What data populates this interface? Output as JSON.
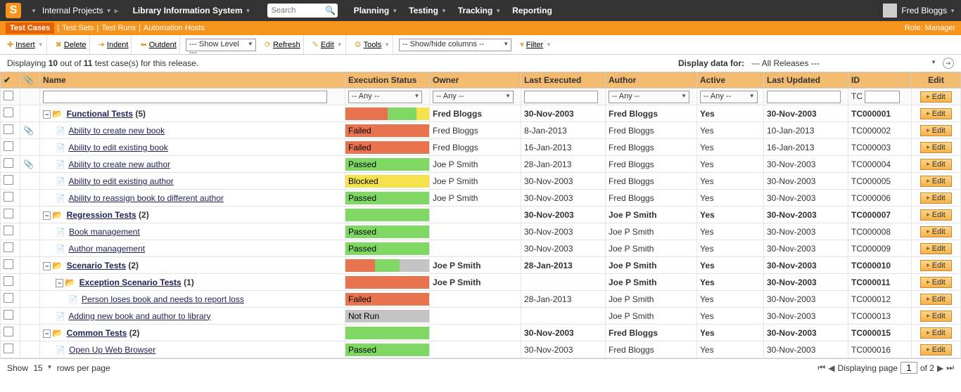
{
  "top": {
    "breadcrumb1": "Internal Projects",
    "breadcrumb2": "Library Information System",
    "search_placeholder": "Search",
    "nav": {
      "planning": "Planning",
      "testing": "Testing",
      "tracking": "Tracking",
      "reporting": "Reporting"
    },
    "user": "Fred Bloggs"
  },
  "subnav": {
    "active": "Test Cases",
    "links": [
      "Test Sets",
      "Test Runs",
      "Automation Hosts"
    ],
    "role": "Role: Manager"
  },
  "toolbar": {
    "insert": "Insert",
    "delete": "Delete",
    "indent": "Indent",
    "outdent": "Outdent",
    "showlevel": "--- Show Level ---",
    "refresh": "Refresh",
    "edit": "Edit",
    "tools": "Tools",
    "showhide": "-- Show/hide columns --",
    "filter": "Filter"
  },
  "info": {
    "prefix": "Displaying ",
    "count": "10",
    "mid": " out of ",
    "total": "11",
    "suffix": " test case(s) for this release.",
    "displayfor": "Display data for:",
    "releases": "--- All Releases ---"
  },
  "columns": {
    "name": "Name",
    "execstatus": "Execution Status",
    "owner": "Owner",
    "lastexec": "Last Executed",
    "author": "Author",
    "active": "Active",
    "lastupdated": "Last Updated",
    "id": "ID",
    "edit": "Edit"
  },
  "filter": {
    "any": "-- Any --",
    "idprefix": "TC"
  },
  "editlabel": "Edit",
  "rows": [
    {
      "type": "folder",
      "indent": 0,
      "name": "Functional Tests",
      "count": "(5)",
      "status": "bar",
      "bar": [
        [
          "failed",
          50
        ],
        [
          "passed",
          35
        ],
        [
          "blocked",
          15
        ]
      ],
      "owner": "Fred Bloggs",
      "lastexec": "30-Nov-2003",
      "author": "Fred Bloggs",
      "active": "Yes",
      "lastupd": "30-Nov-2003",
      "id": "TC000001",
      "bold": true
    },
    {
      "type": "item",
      "indent": 1,
      "attach": true,
      "name": "Ability to create new book",
      "status": "Failed",
      "statuscls": "red",
      "owner": "Fred Bloggs",
      "lastexec": "8-Jan-2013",
      "author": "Fred Bloggs",
      "active": "Yes",
      "lastupd": "10-Jan-2013",
      "id": "TC000002"
    },
    {
      "type": "item",
      "indent": 1,
      "name": "Ability to edit existing book",
      "status": "Failed",
      "statuscls": "red",
      "owner": "Fred Bloggs",
      "lastexec": "16-Jan-2013",
      "author": "Fred Bloggs",
      "active": "Yes",
      "lastupd": "16-Jan-2013",
      "id": "TC000003"
    },
    {
      "type": "item",
      "indent": 1,
      "attach": true,
      "name": "Ability to create new author",
      "status": "Passed",
      "statuscls": "green",
      "owner": "Joe P Smith",
      "lastexec": "28-Jan-2013",
      "author": "Fred Bloggs",
      "active": "Yes",
      "lastupd": "30-Nov-2003",
      "id": "TC000004"
    },
    {
      "type": "item",
      "indent": 1,
      "name": "Ability to edit existing author",
      "status": "Blocked",
      "statuscls": "yellow",
      "owner": "Joe P Smith",
      "lastexec": "30-Nov-2003",
      "author": "Fred Bloggs",
      "active": "Yes",
      "lastupd": "30-Nov-2003",
      "id": "TC000005"
    },
    {
      "type": "item",
      "indent": 1,
      "name": "Ability to reassign book to different author",
      "status": "Passed",
      "statuscls": "green",
      "owner": "Joe P Smith",
      "lastexec": "30-Nov-2003",
      "author": "Fred Bloggs",
      "active": "Yes",
      "lastupd": "30-Nov-2003",
      "id": "TC000006"
    },
    {
      "type": "folder",
      "indent": 0,
      "name": "Regression Tests",
      "count": "(2)",
      "status": "bar",
      "bar": [
        [
          "passed",
          100
        ]
      ],
      "owner": "",
      "lastexec": "30-Nov-2003",
      "author": "Joe P Smith",
      "active": "Yes",
      "lastupd": "30-Nov-2003",
      "id": "TC000007",
      "bold": true
    },
    {
      "type": "item",
      "indent": 1,
      "name": "Book management",
      "status": "Passed",
      "statuscls": "green",
      "owner": "",
      "lastexec": "30-Nov-2003",
      "author": "Joe P Smith",
      "active": "Yes",
      "lastupd": "30-Nov-2003",
      "id": "TC000008"
    },
    {
      "type": "item",
      "indent": 1,
      "name": "Author management",
      "status": "Passed",
      "statuscls": "green",
      "owner": "",
      "lastexec": "30-Nov-2003",
      "author": "Joe P Smith",
      "active": "Yes",
      "lastupd": "30-Nov-2003",
      "id": "TC000009"
    },
    {
      "type": "folder",
      "indent": 0,
      "name": "Scenario Tests",
      "count": "(2)",
      "status": "bar",
      "bar": [
        [
          "failed",
          35
        ],
        [
          "passed",
          30
        ],
        [
          "notrun",
          35
        ]
      ],
      "owner": "Joe P Smith",
      "lastexec": "28-Jan-2013",
      "author": "Joe P Smith",
      "active": "Yes",
      "lastupd": "30-Nov-2003",
      "id": "TC000010",
      "bold": true
    },
    {
      "type": "folder",
      "indent": 1,
      "name": "Exception Scenario Tests",
      "count": "(1)",
      "status": "bar",
      "bar": [
        [
          "failed",
          100
        ]
      ],
      "owner": "Joe P Smith",
      "lastexec": "",
      "author": "Joe P Smith",
      "active": "Yes",
      "lastupd": "30-Nov-2003",
      "id": "TC000011",
      "bold": true
    },
    {
      "type": "item",
      "indent": 2,
      "name": "Person loses book and needs to report loss",
      "status": "Failed",
      "statuscls": "red",
      "owner": "",
      "lastexec": "28-Jan-2013",
      "author": "Joe P Smith",
      "active": "Yes",
      "lastupd": "30-Nov-2003",
      "id": "TC000012"
    },
    {
      "type": "item",
      "indent": 1,
      "name": "Adding new book and author to library",
      "status": "Not Run",
      "statuscls": "gray",
      "owner": "",
      "lastexec": "",
      "author": "Joe P Smith",
      "active": "Yes",
      "lastupd": "30-Nov-2003",
      "id": "TC000013"
    },
    {
      "type": "folder",
      "indent": 0,
      "name": "Common Tests",
      "count": "(2)",
      "status": "bar",
      "bar": [
        [
          "passed",
          100
        ]
      ],
      "owner": "",
      "lastexec": "30-Nov-2003",
      "author": "Fred Bloggs",
      "active": "Yes",
      "lastupd": "30-Nov-2003",
      "id": "TC000015",
      "bold": true
    },
    {
      "type": "item",
      "indent": 1,
      "name": "Open Up Web Browser",
      "status": "Passed",
      "statuscls": "green",
      "owner": "",
      "lastexec": "30-Nov-2003",
      "author": "Fred Bloggs",
      "active": "Yes",
      "lastupd": "30-Nov-2003",
      "id": "TC000016"
    }
  ],
  "pager": {
    "show": "Show",
    "perpage": "15",
    "rowslabel": "rows per page",
    "displaying": "Displaying page",
    "page": "1",
    "of": "of 2"
  }
}
